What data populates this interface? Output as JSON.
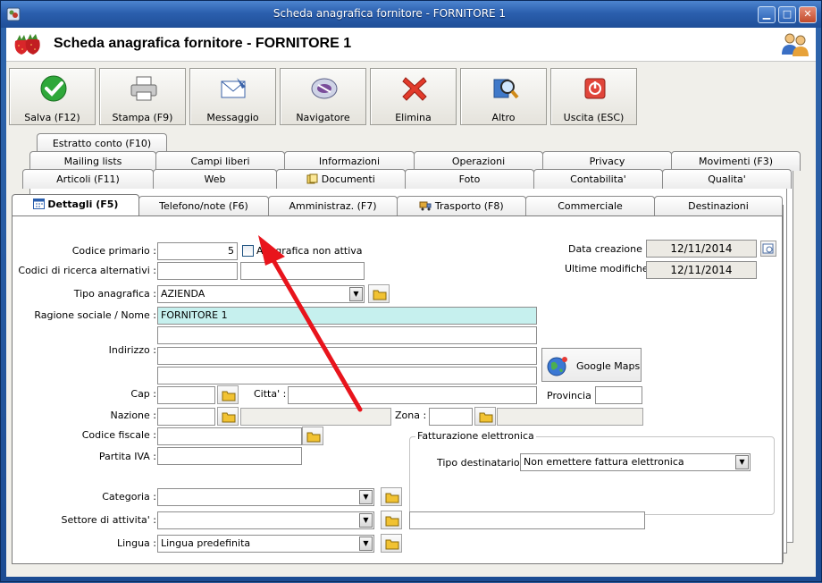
{
  "window": {
    "title": "Scheda anagrafica fornitore - FORNITORE 1",
    "min_label": "▁",
    "max_label": "□",
    "close_label": "✕"
  },
  "header": {
    "title": "Scheda anagrafica fornitore - FORNITORE 1",
    "logo_icon": "strawberry-icon",
    "users_icon": "users-icon"
  },
  "toolbar": {
    "buttons": [
      {
        "label": "Salva (F12)",
        "icon": "check-icon"
      },
      {
        "label": "Stampa (F9)",
        "icon": "printer-icon"
      },
      {
        "label": "Messaggio",
        "icon": "envelope-icon"
      },
      {
        "label": "Navigatore",
        "icon": "navigator-icon"
      },
      {
        "label": "Elimina",
        "icon": "delete-icon"
      },
      {
        "label": "Altro",
        "icon": "search-icon"
      },
      {
        "label": "Uscita (ESC)",
        "icon": "exit-icon"
      }
    ]
  },
  "tabs": {
    "row1": [
      "Estratto conto (F10)"
    ],
    "row2": [
      "Mailing lists",
      "Campi liberi",
      "Informazioni",
      "Operazioni",
      "Privacy",
      "Movimenti (F3)"
    ],
    "row3": [
      "Articoli (F11)",
      "Web",
      "Documenti",
      "Foto",
      "Contabilita'",
      "Qualita'"
    ],
    "row4": [
      "Dettagli (F5)",
      "Telefono/note (F6)",
      "Amministraz. (F7)",
      "Trasporto (F8)",
      "Commerciale",
      "Destinazioni"
    ]
  },
  "form": {
    "codice_primario_label": "Codice primario :",
    "codice_primario_value": "5",
    "non_attiva_label": "Anagrafica non attiva",
    "codici_ricerca_label": "Codici di ricerca alternativi :",
    "codici_ricerca_1": "",
    "codici_ricerca_2": "",
    "tipo_anagrafica_label": "Tipo anagrafica :",
    "tipo_anagrafica_value": "AZIENDA",
    "ragione_sociale_label": "Ragione sociale / Nome :",
    "ragione_sociale_value": "FORNITORE 1",
    "ragione_sociale_2": "",
    "indirizzo_label": "Indirizzo :",
    "indirizzo_1": "",
    "indirizzo_2": "",
    "google_maps_label": "Google Maps",
    "cap_label": "Cap :",
    "cap_value": "",
    "citta_label": "Citta' :",
    "citta_value": "",
    "provincia_label": "Provincia :",
    "provincia_value": "",
    "nazione_label": "Nazione :",
    "nazione_value": "",
    "nazione_desc": "",
    "zona_label": "Zona :",
    "zona_value": "",
    "zona_desc": "",
    "codice_fiscale_label": "Codice fiscale :",
    "codice_fiscale_value": "",
    "partita_iva_label": "Partita IVA :",
    "partita_iva_value": "",
    "fatturazione_title": "Fatturazione elettronica",
    "tipo_destinatario_label": "Tipo destinatario :",
    "tipo_destinatario_value": "Non emettere fattura elettronica",
    "categoria_label": "Categoria :",
    "categoria_value": "",
    "settore_label": "Settore di attivita' :",
    "settore_value": "",
    "settore_extra": "",
    "lingua_label": "Lingua :",
    "lingua_value": "Lingua predefinita",
    "data_creazione_label": "Data creazione :",
    "data_creazione_value": "12/11/2014",
    "ultime_modifiche_label": "Ultime modifiche :",
    "ultime_modifiche_value": "12/11/2014"
  },
  "colors": {
    "titlebar": "#2b5fae",
    "highlight_field": "#c6f0ee",
    "annotation_arrow": "#e8141c"
  }
}
